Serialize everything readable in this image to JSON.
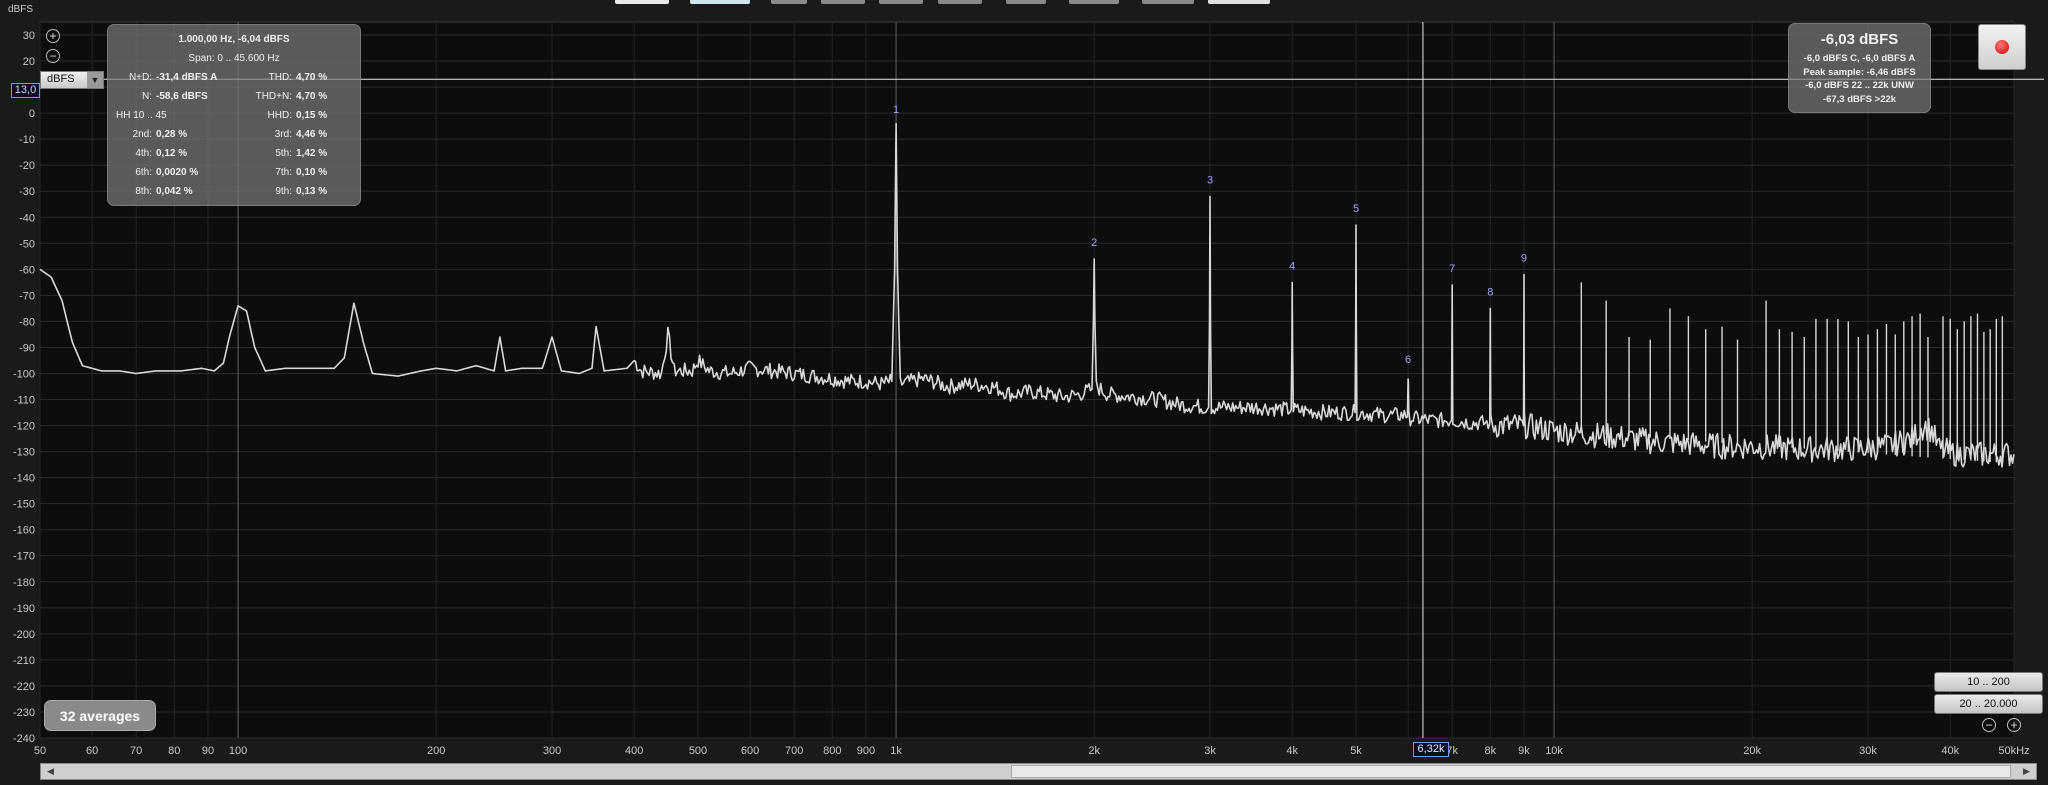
{
  "toolbar": {
    "buttons": [
      {
        "color": "#e8e8e8",
        "left": 615,
        "width": 54
      },
      {
        "color": "#cfe8f0",
        "left": 690,
        "width": 60
      },
      {
        "color": "#8a8a8a",
        "left": 771,
        "width": 36
      },
      {
        "color": "#8a8a8a",
        "left": 821,
        "width": 44
      },
      {
        "color": "#8a8a8a",
        "left": 879,
        "width": 44
      },
      {
        "color": "#8a8a8a",
        "left": 938,
        "width": 44
      },
      {
        "color": "#8a8a8a",
        "left": 1006,
        "width": 40
      },
      {
        "color": "#8a8a8a",
        "left": 1069,
        "width": 50
      },
      {
        "color": "#8a8a8a",
        "left": 1142,
        "width": 52
      },
      {
        "color": "#e0e0e0",
        "left": 1208,
        "width": 62
      }
    ]
  },
  "axis": {
    "y_unit_label": "dBFS",
    "unit_select_value": "dBFS",
    "y_value_readout": "13,0",
    "cursor_readout": "6,32k",
    "zoom_in_icon": "zoom-in-icon",
    "zoom_out_icon": "zoom-out-icon"
  },
  "stats": {
    "header": "1.000,00 Hz, -6,04 dBFS",
    "span": "Span: 0 .. 45.600 Hz",
    "rows": [
      {
        "k1": "N+D:",
        "v1": "-31,4 dBFS A",
        "k2": "THD:",
        "v2": "4,70 %"
      },
      {
        "k1": "N:",
        "v1": "-58,6 dBFS",
        "k2": "THD+N:",
        "v2": "4,70 %"
      },
      {
        "k1": "HH 10 .. 45",
        "v1": "",
        "k2": "HHD:",
        "v2": "0,15 %"
      },
      {
        "k1": "2nd:",
        "v1": "0,28 %",
        "k2": "3rd:",
        "v2": "4,46 %"
      },
      {
        "k1": "4th:",
        "v1": "0,12 %",
        "k2": "5th:",
        "v2": "1,42 %"
      },
      {
        "k1": "6th:",
        "v1": "0,0020 %",
        "k2": "7th:",
        "v2": "0,10 %"
      },
      {
        "k1": "8th:",
        "v1": "0,042 %",
        "k2": "9th:",
        "v2": "0,13 %"
      }
    ]
  },
  "level": {
    "main": "-6,03 dBFS",
    "lines": [
      "-6,0 dBFS C, -6,0 dBFS A",
      "Peak sample: -6,46 dBFS",
      "-6,0 dBFS 22 .. 22k UNW",
      "-67,3 dBFS >22k"
    ]
  },
  "record_button": {
    "icon": "record-icon",
    "color": "#d40000"
  },
  "averages_label": "32 averages",
  "range_buttons": [
    "10 .. 200",
    "20 .. 20.000"
  ],
  "chart_data": {
    "type": "line",
    "xscale": "log",
    "xlim": [
      50,
      50000
    ],
    "ylim": [
      -240,
      35
    ],
    "ylabel": "dBFS",
    "y_ticks": [
      "30",
      "20",
      "10",
      "0",
      "-10",
      "-20",
      "-30",
      "-40",
      "-50",
      "-60",
      "-70",
      "-80",
      "-90",
      "-100",
      "-110",
      "-120",
      "-130",
      "-140",
      "-150",
      "-160",
      "-170",
      "-180",
      "-190",
      "-200",
      "-210",
      "-220",
      "-230",
      "-240"
    ],
    "x_ticks": [
      {
        "f": 50,
        "label": "50"
      },
      {
        "f": 60,
        "label": "60"
      },
      {
        "f": 70,
        "label": "70"
      },
      {
        "f": 80,
        "label": "80"
      },
      {
        "f": 90,
        "label": "90"
      },
      {
        "f": 100,
        "label": "100"
      },
      {
        "f": 200,
        "label": "200"
      },
      {
        "f": 300,
        "label": "300"
      },
      {
        "f": 400,
        "label": "400"
      },
      {
        "f": 500,
        "label": "500"
      },
      {
        "f": 600,
        "label": "600"
      },
      {
        "f": 700,
        "label": "700"
      },
      {
        "f": 800,
        "label": "800"
      },
      {
        "f": 900,
        "label": "900"
      },
      {
        "f": 1000,
        "label": "1k"
      },
      {
        "f": 2000,
        "label": "2k"
      },
      {
        "f": 3000,
        "label": "3k"
      },
      {
        "f": 4000,
        "label": "4k"
      },
      {
        "f": 5000,
        "label": "5k"
      },
      {
        "f": 7000,
        "label": "7k"
      },
      {
        "f": 8000,
        "label": "8k"
      },
      {
        "f": 9000,
        "label": "9k"
      },
      {
        "f": 10000,
        "label": "10k"
      },
      {
        "f": 20000,
        "label": "20k"
      },
      {
        "f": 30000,
        "label": "30k"
      },
      {
        "f": 40000,
        "label": "40k"
      },
      {
        "f": 50000,
        "label": "50kHz"
      }
    ],
    "cursor_hz": 6320,
    "horizontal_cursor_db": 13,
    "series": [
      {
        "color": "#d8d8d8",
        "points": [
          [
            50,
            -60
          ],
          [
            52,
            -63
          ],
          [
            54,
            -72
          ],
          [
            56,
            -88
          ],
          [
            58,
            -97
          ],
          [
            62,
            -99
          ],
          [
            66,
            -99
          ],
          [
            70,
            -100
          ],
          [
            75,
            -99
          ],
          [
            82,
            -99
          ],
          [
            88,
            -98
          ],
          [
            92,
            -99
          ],
          [
            95,
            -96
          ],
          [
            97,
            -86
          ],
          [
            100,
            -74
          ],
          [
            103,
            -76
          ],
          [
            106,
            -90
          ],
          [
            110,
            -99
          ],
          [
            118,
            -98
          ],
          [
            130,
            -98
          ],
          [
            140,
            -98
          ],
          [
            145,
            -94
          ],
          [
            150,
            -73
          ],
          [
            155,
            -88
          ],
          [
            160,
            -100
          ],
          [
            175,
            -101
          ],
          [
            190,
            -99
          ],
          [
            200,
            -98
          ],
          [
            215,
            -99
          ],
          [
            230,
            -97
          ],
          [
            245,
            -99
          ],
          [
            250,
            -86
          ],
          [
            255,
            -99
          ],
          [
            270,
            -98
          ],
          [
            290,
            -98
          ],
          [
            300,
            -86
          ],
          [
            310,
            -99
          ],
          [
            330,
            -100
          ],
          [
            345,
            -98
          ],
          [
            350,
            -82
          ],
          [
            360,
            -99
          ],
          [
            390,
            -98
          ],
          [
            400,
            -95
          ],
          [
            410,
            -99
          ],
          [
            440,
            -100
          ],
          [
            450,
            -85
          ],
          [
            460,
            -99
          ],
          [
            490,
            -99
          ],
          [
            500,
            -95
          ],
          [
            520,
            -99
          ],
          [
            560,
            -100
          ],
          [
            600,
            -98
          ],
          [
            650,
            -99
          ],
          [
            700,
            -100
          ],
          [
            750,
            -101
          ],
          [
            800,
            -102
          ],
          [
            850,
            -103
          ],
          [
            900,
            -103
          ],
          [
            950,
            -104
          ],
          [
            985,
            -103
          ],
          [
            995,
            -60
          ],
          [
            1000,
            -4
          ],
          [
            1005,
            -60
          ],
          [
            1015,
            -104
          ],
          [
            1100,
            -102
          ],
          [
            1200,
            -105
          ],
          [
            1300,
            -104
          ],
          [
            1400,
            -105
          ],
          [
            1500,
            -108
          ],
          [
            1600,
            -107
          ],
          [
            1700,
            -108
          ],
          [
            1800,
            -109
          ],
          [
            1900,
            -108
          ],
          [
            1985,
            -106
          ],
          [
            1995,
            -80
          ],
          [
            2000,
            -56
          ],
          [
            2005,
            -80
          ],
          [
            2015,
            -105
          ],
          [
            2100,
            -108
          ],
          [
            2300,
            -109
          ],
          [
            2500,
            -110
          ],
          [
            2700,
            -112
          ],
          [
            2985,
            -113
          ],
          [
            2995,
            -80
          ],
          [
            3000,
            -32
          ],
          [
            3005,
            -80
          ],
          [
            3015,
            -113
          ],
          [
            3300,
            -113
          ],
          [
            3600,
            -113
          ],
          [
            3985,
            -114
          ],
          [
            3995,
            -90
          ],
          [
            4000,
            -65
          ],
          [
            4005,
            -90
          ],
          [
            4015,
            -114
          ],
          [
            4500,
            -115
          ],
          [
            4985,
            -115
          ],
          [
            4995,
            -80
          ],
          [
            5000,
            -43
          ],
          [
            5005,
            -80
          ],
          [
            5015,
            -115
          ],
          [
            5500,
            -116
          ],
          [
            5985,
            -116
          ],
          [
            5995,
            -105
          ],
          [
            6000,
            -101
          ],
          [
            6005,
            -105
          ],
          [
            6015,
            -117
          ],
          [
            6500,
            -118
          ],
          [
            6985,
            -118
          ],
          [
            6995,
            -90
          ],
          [
            7000,
            -66
          ],
          [
            7005,
            -90
          ],
          [
            7015,
            -118
          ],
          [
            7500,
            -119
          ],
          [
            7985,
            -119
          ],
          [
            7995,
            -95
          ],
          [
            8000,
            -75
          ],
          [
            8005,
            -95
          ],
          [
            8015,
            -120
          ],
          [
            8500,
            -120
          ],
          [
            8985,
            -120
          ],
          [
            8995,
            -90
          ],
          [
            9000,
            -62
          ],
          [
            9005,
            -90
          ],
          [
            9015,
            -120
          ],
          [
            9500,
            -121
          ],
          [
            10000,
            -122
          ],
          [
            11000,
            -123
          ],
          [
            12000,
            -124
          ],
          [
            13000,
            -125
          ],
          [
            14000,
            -126
          ],
          [
            16000,
            -127
          ],
          [
            18000,
            -128
          ],
          [
            20000,
            -128
          ],
          [
            24000,
            -129
          ],
          [
            28000,
            -129
          ],
          [
            32000,
            -128
          ],
          [
            35000,
            -125
          ],
          [
            36500,
            -120
          ],
          [
            37500,
            -122
          ],
          [
            38500,
            -129
          ],
          [
            41000,
            -131
          ],
          [
            45000,
            -131
          ],
          [
            50000,
            -131
          ]
        ],
        "spurs": [
          [
            11000,
            -65
          ],
          [
            12000,
            -72
          ],
          [
            13000,
            -86
          ],
          [
            14000,
            -87
          ],
          [
            15000,
            -75
          ],
          [
            16000,
            -78
          ],
          [
            17000,
            -83
          ],
          [
            18000,
            -82
          ],
          [
            19000,
            -87
          ],
          [
            21000,
            -72
          ],
          [
            22000,
            -83
          ],
          [
            23000,
            -84
          ],
          [
            24000,
            -86
          ],
          [
            25000,
            -79
          ],
          [
            26000,
            -79
          ],
          [
            27000,
            -79
          ],
          [
            28000,
            -80
          ],
          [
            29000,
            -86
          ],
          [
            30000,
            -85
          ],
          [
            31000,
            -83
          ],
          [
            32000,
            -81
          ],
          [
            33000,
            -85
          ],
          [
            34000,
            -80
          ],
          [
            35000,
            -78
          ],
          [
            36000,
            -77
          ],
          [
            37000,
            -86
          ],
          [
            39000,
            -78
          ],
          [
            40000,
            -79
          ],
          [
            41000,
            -83
          ],
          [
            42000,
            -80
          ],
          [
            43000,
            -78
          ],
          [
            44000,
            -77
          ],
          [
            45000,
            -84
          ],
          [
            46000,
            -83
          ],
          [
            47000,
            -79
          ],
          [
            48000,
            -78
          ]
        ]
      }
    ],
    "harmonic_labels": [
      {
        "n": "1",
        "f": 1000,
        "db": 0
      },
      {
        "n": "2",
        "f": 2000,
        "db": -51
      },
      {
        "n": "3",
        "f": 3000,
        "db": -27
      },
      {
        "n": "4",
        "f": 4000,
        "db": -60
      },
      {
        "n": "5",
        "f": 5000,
        "db": -38
      },
      {
        "n": "6",
        "f": 6000,
        "db": -96
      },
      {
        "n": "7",
        "f": 7000,
        "db": -61
      },
      {
        "n": "8",
        "f": 8000,
        "db": -70
      },
      {
        "n": "9",
        "f": 9000,
        "db": -57
      }
    ]
  }
}
